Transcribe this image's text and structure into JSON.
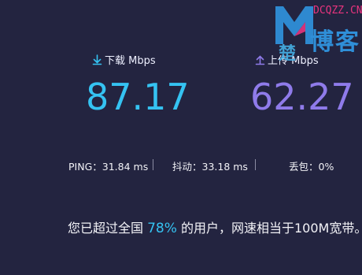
{
  "download": {
    "label": "下载 Mbps",
    "value": "87.17",
    "color": "#35c3f2",
    "icon": "download-arrow-icon"
  },
  "upload": {
    "label": "上传 Mbps",
    "value": "62.27",
    "color": "#8f7bea",
    "icon": "upload-arrow-icon"
  },
  "stats": {
    "ping": "PING：31.84 ms",
    "jitter": "抖动：33.18 ms",
    "loss": "丢包：0%"
  },
  "summary": {
    "prefix": "您已超过全国 ",
    "percent": "78%",
    "suffix": " 的用户，网速相当于100M宽带。"
  },
  "watermark": {
    "url": "DCQZZ.CN",
    "text_left": "楚",
    "text_right": "博客",
    "logo_color": "#2f8fd8"
  }
}
